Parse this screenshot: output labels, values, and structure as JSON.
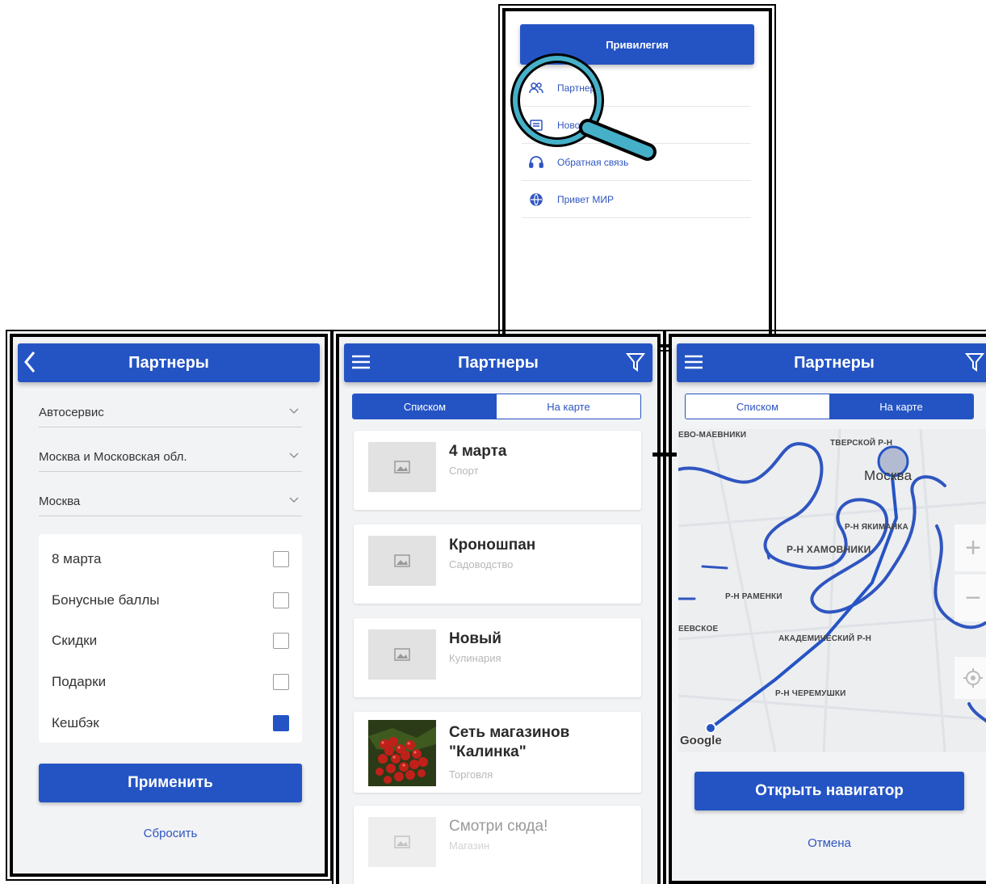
{
  "menu": {
    "header_title": "Привилегия",
    "items": [
      {
        "label": "Партнеры",
        "icon": "people-icon"
      },
      {
        "label": "Новости",
        "icon": "news-icon"
      },
      {
        "label": "Обратная связь",
        "icon": "headset-icon"
      },
      {
        "label": "Привет МИР",
        "icon": "globe-icon"
      }
    ]
  },
  "filter": {
    "header_title": "Партнеры",
    "dropdowns": [
      "Автосервис",
      "Москва и Московская обл.",
      "Москва"
    ],
    "checks": [
      {
        "label": "8 марта",
        "checked": false
      },
      {
        "label": "Бонусные баллы",
        "checked": false
      },
      {
        "label": "Скидки",
        "checked": false
      },
      {
        "label": "Подарки",
        "checked": false
      },
      {
        "label": "Кешбэк",
        "checked": true
      }
    ],
    "apply_label": "Применить",
    "reset_label": "Сбросить"
  },
  "list": {
    "header_title": "Партнеры",
    "tabs": [
      "Списком",
      "На карте"
    ],
    "active_tab": 0,
    "items": [
      {
        "title": "4 марта",
        "category": "Спорт"
      },
      {
        "title": "Кроношпан",
        "category": "Садоводство"
      },
      {
        "title": "Новый",
        "category": "Кулинария"
      },
      {
        "title": "Сеть магазинов \"Калинка\"",
        "category": "Торговля"
      },
      {
        "title": "Смотри сюда!",
        "category": "Магазин"
      }
    ]
  },
  "map": {
    "header_title": "Партнеры",
    "tabs": [
      "Списком",
      "На карте"
    ],
    "active_tab": 1,
    "labels": {
      "top_left": "ЕВО-МАЕВНИКИ",
      "tverskoy": "ТВЕРСКОЙ Р-Н",
      "moskva": "Москва",
      "yakimanka": "Р-Н ЯКИМАНКА",
      "khamovniki": "Р-Н ХАМОВНИКИ",
      "ramenki": "Р-Н РАМЕНКИ",
      "evskoe": "ЕЕВСКОЕ",
      "akadem": "АКАДЕМИЧЕСКИЙ Р-Н",
      "cheremushki": "Р-Н ЧЕРЕМУШКИ"
    },
    "google": "Google",
    "navigator_label": "Открыть навигатор",
    "cancel_label": "Отмена"
  },
  "colors": {
    "brand": "#2454c4",
    "magnifier": "#45b0c8"
  }
}
